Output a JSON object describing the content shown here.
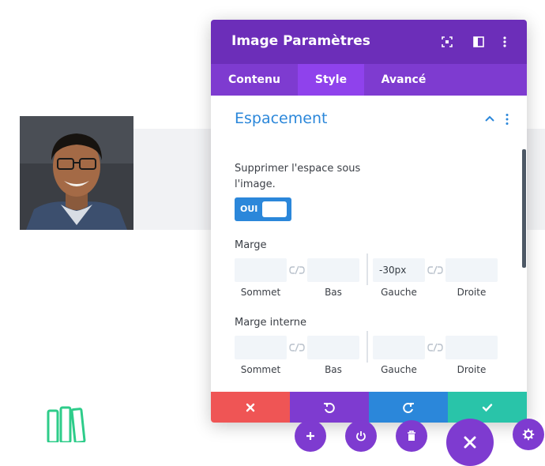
{
  "panel": {
    "title": "Image Paramètres",
    "header_icons": [
      "focus-icon",
      "split-view-icon",
      "more-vertical-icon"
    ],
    "tabs": [
      {
        "label": "Contenu",
        "active": false
      },
      {
        "label": "Style",
        "active": true
      },
      {
        "label": "Avancé",
        "active": false
      }
    ]
  },
  "section": {
    "title": "Espacement",
    "remove_space_label_line1": "Supprimer l'espace sous",
    "remove_space_label_line2": "l'image.",
    "toggle": {
      "label": "OUI",
      "on": true
    },
    "margin": {
      "label": "Marge",
      "top": {
        "label": "Sommet",
        "value": ""
      },
      "bottom": {
        "label": "Bas",
        "value": ""
      },
      "left": {
        "label": "Gauche",
        "value": "-30px"
      },
      "right": {
        "label": "Droite",
        "value": ""
      }
    },
    "padding": {
      "label": "Marge interne",
      "top": {
        "label": "Sommet",
        "value": ""
      },
      "bottom": {
        "label": "Bas",
        "value": ""
      },
      "left": {
        "label": "Gauche",
        "value": ""
      },
      "right": {
        "label": "Droite",
        "value": ""
      }
    }
  },
  "footer": {
    "buttons": [
      {
        "name": "cancel",
        "icon": "close-icon",
        "color": "#ef5555"
      },
      {
        "name": "undo",
        "icon": "undo-icon",
        "color": "#7e3bd0"
      },
      {
        "name": "redo",
        "icon": "redo-icon",
        "color": "#2b87da"
      },
      {
        "name": "save",
        "icon": "check-icon",
        "color": "#29c4a9"
      }
    ]
  },
  "colors": {
    "header": "#6c2eb9",
    "tabs": "#7e3bd0",
    "tab_active": "#8f42ec",
    "accent_blue": "#2b87da",
    "books_green": "#2ecc8a"
  },
  "builder_bar": [
    "plus-icon",
    "power-icon",
    "trash-icon",
    "close-icon",
    "gear-icon"
  ]
}
